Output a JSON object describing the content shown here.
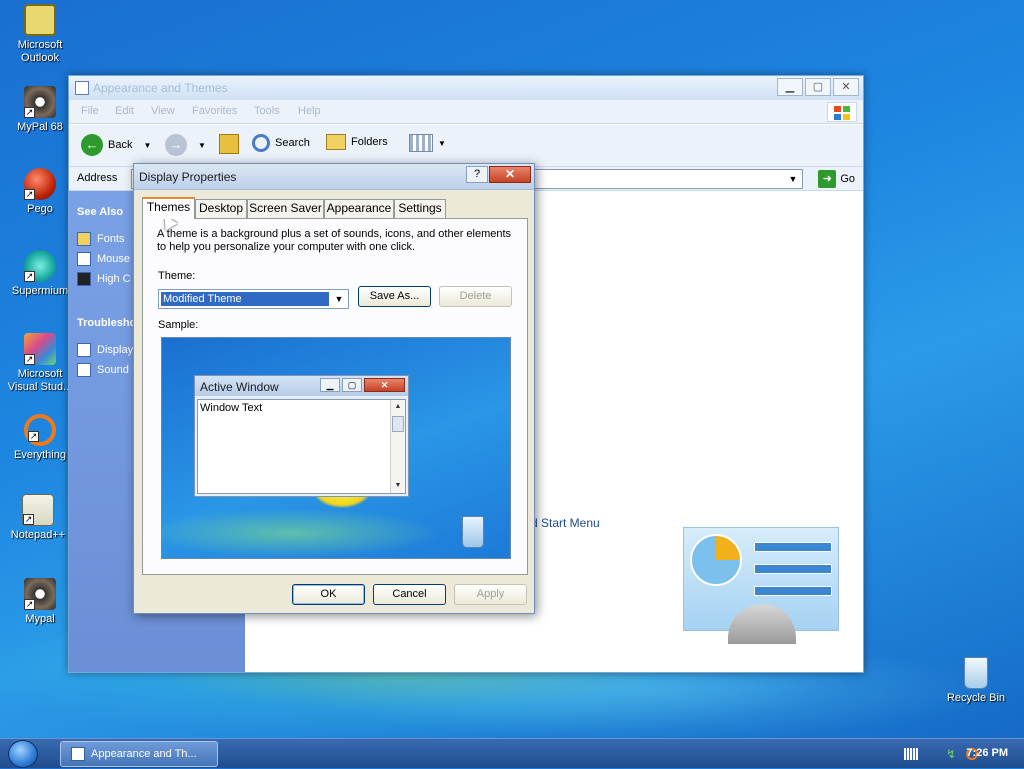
{
  "desktop": {
    "icons": [
      {
        "label": "Microsoft\nOutlook"
      },
      {
        "label": "MyPal 68"
      },
      {
        "label": "Pego"
      },
      {
        "label": "Supermium"
      },
      {
        "label": "Microsoft\nVisual Stud..."
      },
      {
        "label": "Everything"
      },
      {
        "label": "Notepad++"
      },
      {
        "label": "Mypal"
      },
      {
        "label": "Recycle Bin"
      }
    ]
  },
  "explorer": {
    "title": "Appearance and Themes",
    "menu": [
      "File",
      "Edit",
      "View",
      "Favorites",
      "Tools",
      "Help"
    ],
    "toolbar": {
      "back": "Back",
      "search": "Search",
      "folders": "Folders"
    },
    "address": {
      "label": "Address",
      "go": "Go"
    },
    "sidebar": {
      "see_also": "See Also",
      "see_also_items": [
        "Fonts",
        "Mouse",
        "High C"
      ],
      "troubleshooters": "Troublesho",
      "troubleshooter_items": [
        "Display",
        "Sound"
      ]
    },
    "content": {
      "link_fragment": "d Start Menu"
    }
  },
  "dialog": {
    "title": "Display Properties",
    "help": "?",
    "close": "✕",
    "tabs": [
      "Themes",
      "Desktop",
      "Screen Saver",
      "Appearance",
      "Settings"
    ],
    "active_tab": "Themes",
    "description": "A theme is a background plus a set of sounds, icons, and other elements to help you personalize your computer with one click.",
    "theme_label": "Theme:",
    "theme_value": "Modified Theme",
    "save_as": "Save As...",
    "delete": "Delete",
    "sample_label": "Sample:",
    "sample": {
      "window_title": "Active Window",
      "window_text": "Window Text"
    },
    "ok": "OK",
    "cancel": "Cancel",
    "apply": "Apply"
  },
  "taskbar": {
    "task_label": "Appearance and Th...",
    "clock": "7:26 PM"
  }
}
